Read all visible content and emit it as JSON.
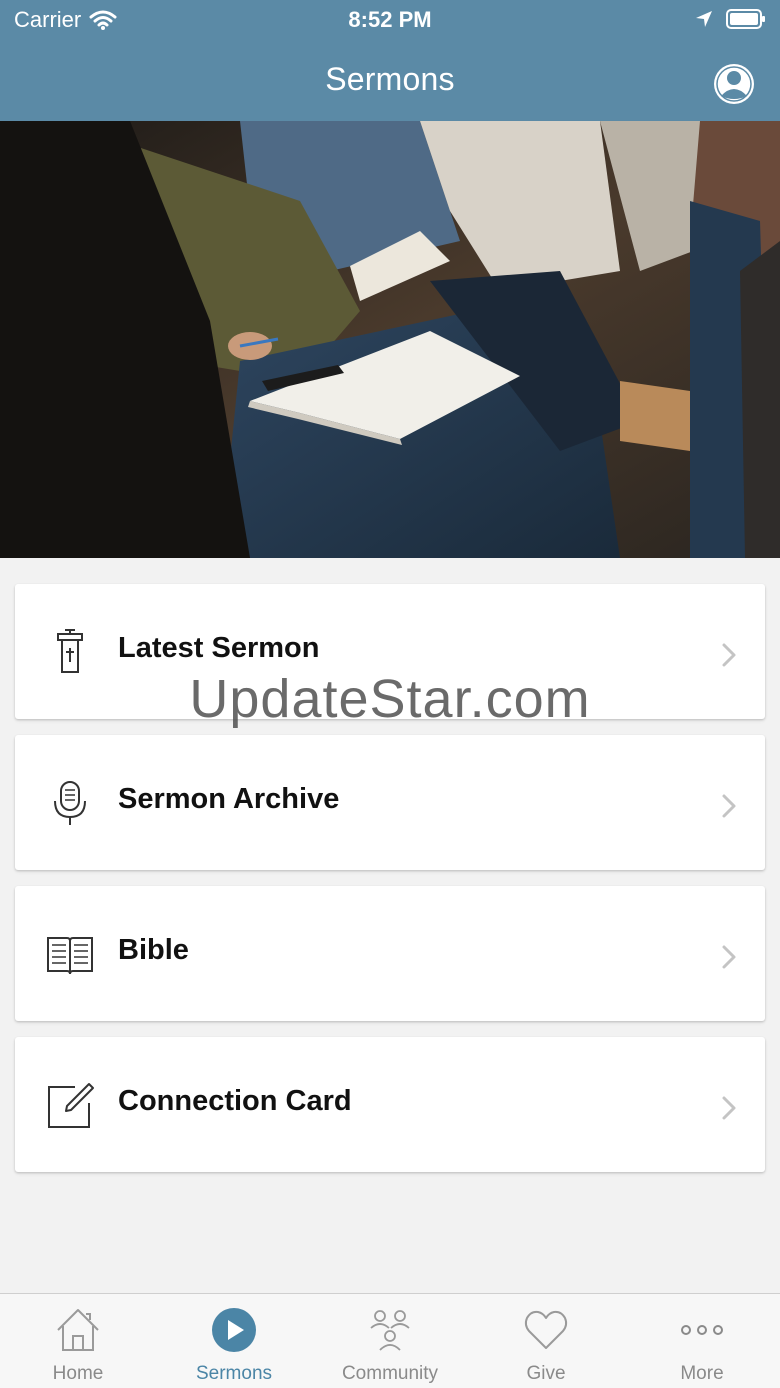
{
  "status": {
    "carrier": "Carrier",
    "time": "8:52 PM"
  },
  "nav": {
    "title": "Sermons"
  },
  "colors": {
    "header": "#5b8aa6",
    "accent": "#4b85a6",
    "tab_inactive": "#8a8a8a"
  },
  "menu": [
    {
      "label": "Latest Sermon",
      "icon": "pulpit-icon"
    },
    {
      "label": "Sermon Archive",
      "icon": "microphone-icon"
    },
    {
      "label": "Bible",
      "icon": "open-book-icon"
    },
    {
      "label": "Connection Card",
      "icon": "edit-icon"
    }
  ],
  "watermark": "UpdateStar.com",
  "tabs": [
    {
      "label": "Home",
      "icon": "home-icon",
      "active": false
    },
    {
      "label": "Sermons",
      "icon": "play-icon",
      "active": true
    },
    {
      "label": "Community",
      "icon": "community-icon",
      "active": false
    },
    {
      "label": "Give",
      "icon": "heart-icon",
      "active": false
    },
    {
      "label": "More",
      "icon": "more-icon",
      "active": false
    }
  ]
}
